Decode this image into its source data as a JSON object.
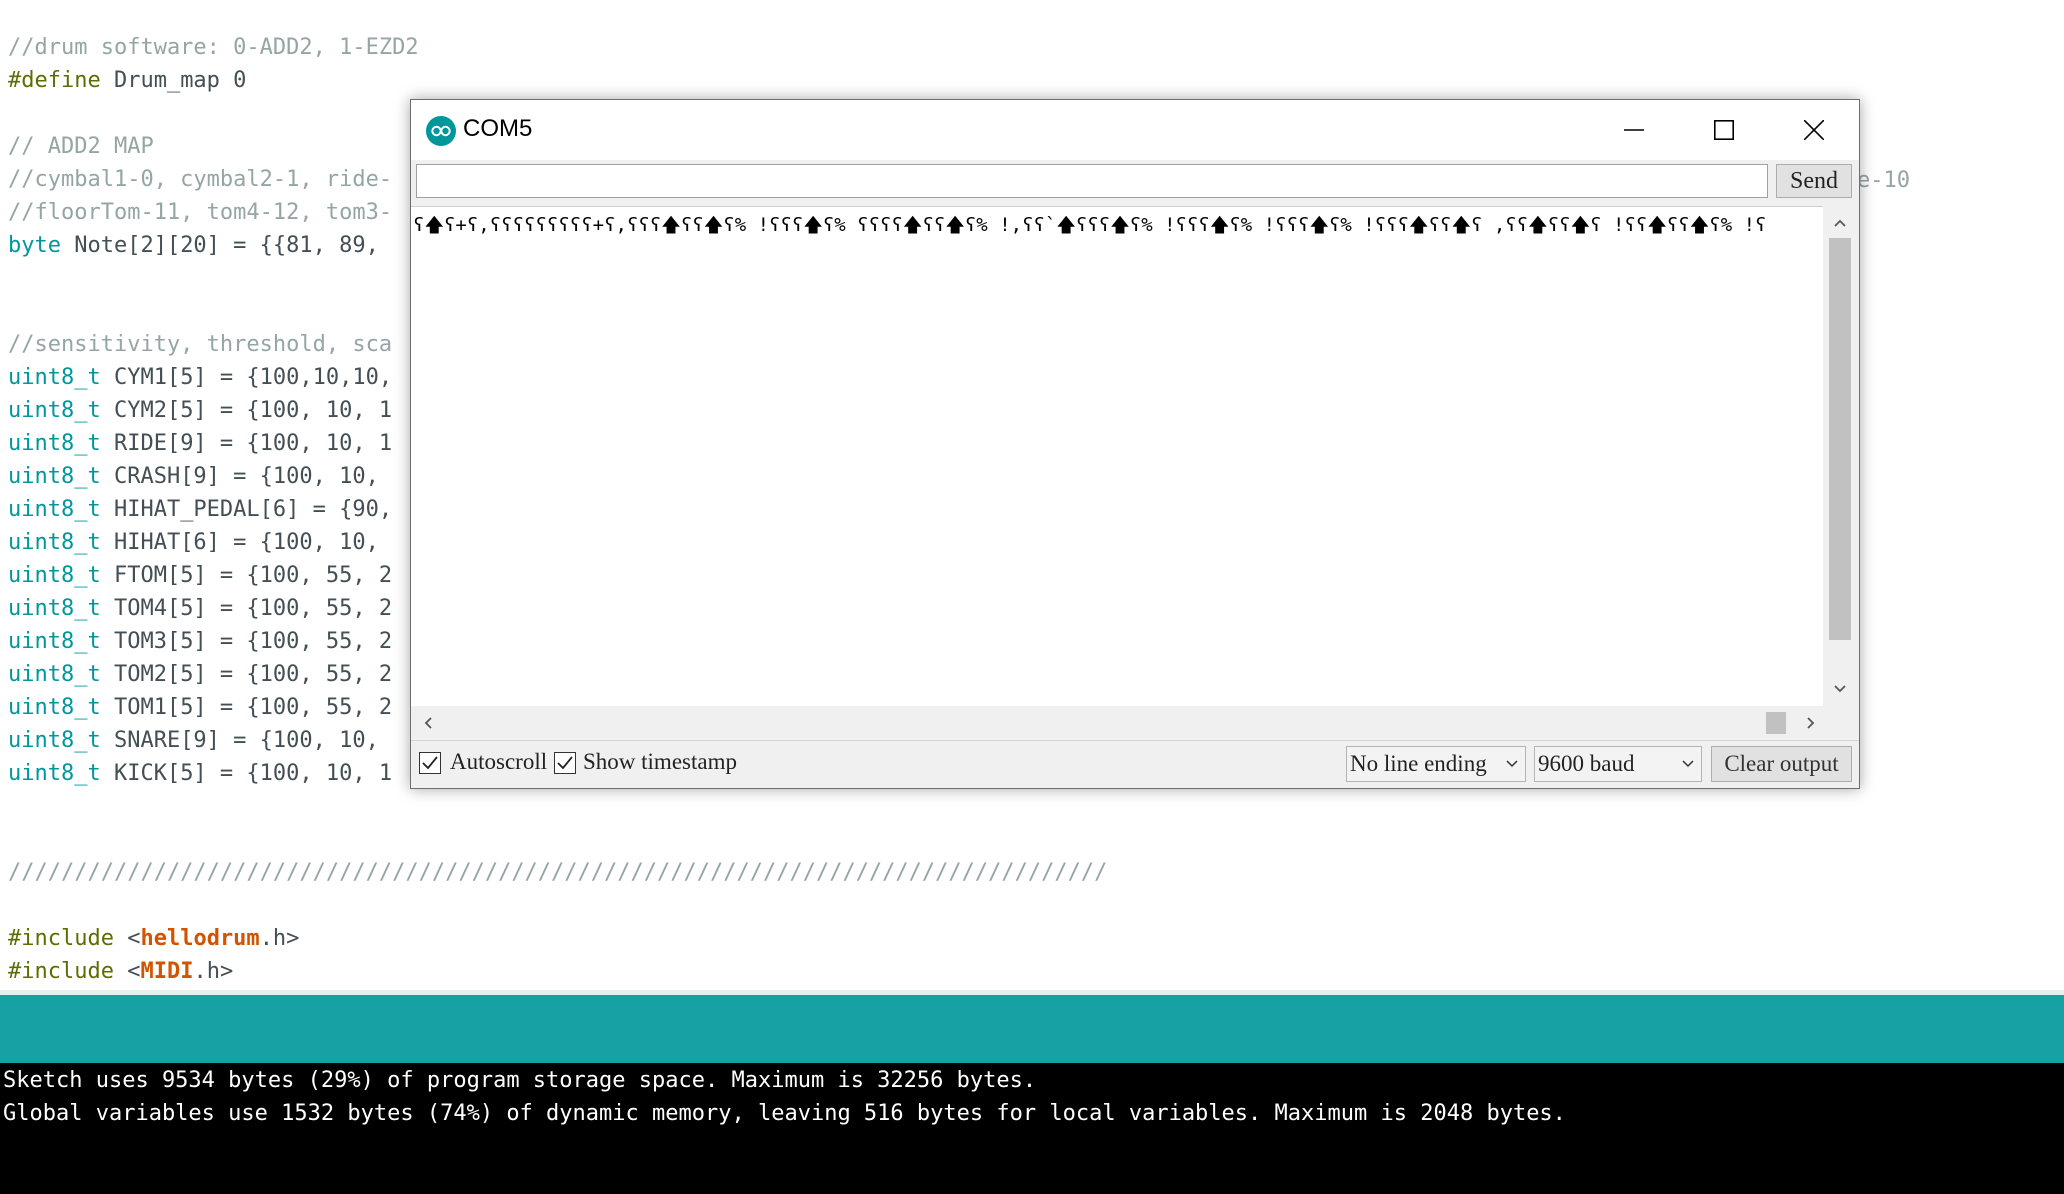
{
  "editor": {
    "lines": [
      [
        {
          "t": "//drum software: 0-ADD2, 1-EZD2",
          "c": "comment"
        }
      ],
      [
        {
          "t": "#define",
          "c": "pre"
        },
        {
          "t": " Drum_map 0",
          "c": "plain"
        }
      ],
      [
        {
          "t": "",
          "c": "plain"
        }
      ],
      [
        {
          "t": "// ADD2 MAP",
          "c": "comment"
        }
      ],
      [
        {
          "t": "//cymbal1-0, cymbal2-1, ride-",
          "c": "comment"
        }
      ],
      [
        {
          "t": "//floorTom-11, tom4-12, tom3-",
          "c": "comment"
        }
      ],
      [
        {
          "t": "byte",
          "c": "type"
        },
        {
          "t": " Note[2][20] = {{81, 89,",
          "c": "plain"
        }
      ],
      [
        {
          "t": "",
          "c": "plain"
        }
      ],
      [
        {
          "t": "",
          "c": "plain"
        }
      ],
      [
        {
          "t": "//sensitivity, threshold, sca",
          "c": "comment"
        }
      ],
      [
        {
          "t": "uint8_t",
          "c": "type"
        },
        {
          "t": " CYM1[5] = {100,10,10,",
          "c": "plain"
        }
      ],
      [
        {
          "t": "uint8_t",
          "c": "type"
        },
        {
          "t": " CYM2[5] = {100, 10, 1",
          "c": "plain"
        }
      ],
      [
        {
          "t": "uint8_t",
          "c": "type"
        },
        {
          "t": " RIDE[9] = {100, 10, 1",
          "c": "plain"
        }
      ],
      [
        {
          "t": "uint8_t",
          "c": "type"
        },
        {
          "t": " CRASH[9] = {100, 10,",
          "c": "plain"
        }
      ],
      [
        {
          "t": "uint8_t",
          "c": "type"
        },
        {
          "t": " HIHAT_PEDAL[6] = {90,",
          "c": "plain"
        }
      ],
      [
        {
          "t": "uint8_t",
          "c": "type"
        },
        {
          "t": " HIHAT[6] = {100, 10,",
          "c": "plain"
        }
      ],
      [
        {
          "t": "uint8_t",
          "c": "type"
        },
        {
          "t": " FTOM[5] = {100, 55, 2",
          "c": "plain"
        }
      ],
      [
        {
          "t": "uint8_t",
          "c": "type"
        },
        {
          "t": " TOM4[5] = {100, 55, 2",
          "c": "plain"
        }
      ],
      [
        {
          "t": "uint8_t",
          "c": "type"
        },
        {
          "t": " TOM3[5] = {100, 55, 2",
          "c": "plain"
        }
      ],
      [
        {
          "t": "uint8_t",
          "c": "type"
        },
        {
          "t": " TOM2[5] = {100, 55, 2",
          "c": "plain"
        }
      ],
      [
        {
          "t": "uint8_t",
          "c": "type"
        },
        {
          "t": " TOM1[5] = {100, 55, 2",
          "c": "plain"
        }
      ],
      [
        {
          "t": "uint8_t",
          "c": "type"
        },
        {
          "t": " SNARE[9] = {100, 10,",
          "c": "plain"
        }
      ],
      [
        {
          "t": "uint8_t",
          "c": "type"
        },
        {
          "t": " KICK[5] = {100, 10, 1",
          "c": "plain"
        }
      ],
      [
        {
          "t": "",
          "c": "plain"
        }
      ],
      [
        {
          "t": "",
          "c": "plain"
        }
      ],
      [
        {
          "t": "///////////////////////////////////////////////////////////////////////////////////",
          "c": "comment"
        }
      ],
      [
        {
          "t": "",
          "c": "plain"
        }
      ],
      [
        {
          "t": "#include",
          "c": "pre"
        },
        {
          "t": " <",
          "c": "plain"
        },
        {
          "t": "hellodrum",
          "c": "lib"
        },
        {
          "t": ".h>",
          "c": "plain"
        }
      ],
      [
        {
          "t": "#include",
          "c": "pre"
        },
        {
          "t": " <",
          "c": "plain"
        },
        {
          "t": "MIDI",
          "c": "lib"
        },
        {
          "t": ".h>",
          "c": "plain"
        }
      ]
    ],
    "overflow_fragment": "e-10"
  },
  "console": {
    "line1": "Sketch uses 9534 bytes (29%) of program storage space. Maximum is 32256 bytes.",
    "line2": "Global variables use 1532 bytes (74%) of dynamic memory, leaving 516 bytes for local variables. Maximum is 2048 bytes."
  },
  "serial_monitor": {
    "title": "COM5",
    "app_icon": "arduino-logo-icon",
    "send_input_value": "",
    "send_label": "Send",
    "output_text": "ʕ🡅ʕ+ʕ,ʕʕʕʕʕʕʕʕʕ+ʕ,ʕʕʕ🡅ʕʕ🡅ʕ% !ʕʕʕ🡅ʕ% ʕʕʕʕ🡅ʕʕ🡅ʕ% !,ʕʕ`🡅ʕʕʕ🡅ʕ% !ʕʕʕ🡅ʕ% !ʕʕʕ🡅ʕ% !ʕʕʕ🡅ʕʕ🡅ʕ ,ʕʕ🡅ʕʕ🡅ʕ !ʕʕ🡅ʕʕ🡅ʕ% !ʕ",
    "autoscroll_label": "Autoscroll",
    "autoscroll_checked": true,
    "timestamp_label": "Show timestamp",
    "timestamp_checked": true,
    "line_ending": "No line ending",
    "baud": "9600 baud",
    "clear_label": "Clear output"
  },
  "colors": {
    "comment": "#95a5a6",
    "preprocessor": "#5e6d03",
    "keyword_type": "#00979c",
    "library": "#d35400",
    "status_bar": "#17a1a5",
    "console_bg": "#000000"
  }
}
